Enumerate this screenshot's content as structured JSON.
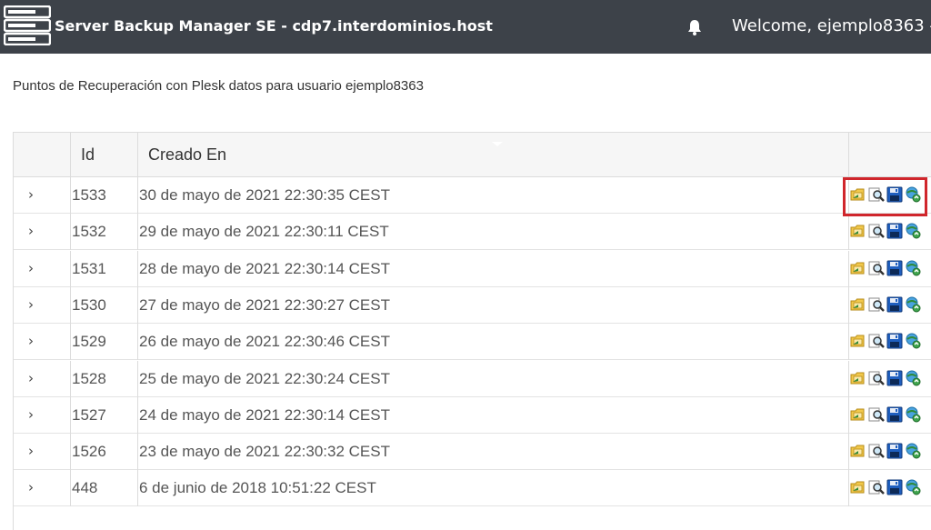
{
  "header": {
    "app_title": "Server Backup Manager SE - cdp7.interdominios.host",
    "welcome": "Welcome, ejemplo8363 -",
    "bar_color": "#3d4249"
  },
  "page": {
    "subtitle": "Puntos de Recuperación con Plesk datos para usuario ejemplo8363"
  },
  "table": {
    "columns": [
      "",
      "Id",
      "Creado En",
      ""
    ],
    "row_icons": [
      "folder-restore-icon",
      "magnifier-browse-icon",
      "floppy-download-icon",
      "network-restore-icon"
    ],
    "rows": [
      {
        "id": "1533",
        "created": "30 de mayo de 2021 22:30:35 CEST"
      },
      {
        "id": "1532",
        "created": "29 de mayo de 2021 22:30:11 CEST"
      },
      {
        "id": "1531",
        "created": "28 de mayo de 2021 22:30:14 CEST"
      },
      {
        "id": "1530",
        "created": "27 de mayo de 2021 22:30:27 CEST"
      },
      {
        "id": "1529",
        "created": "26 de mayo de 2021 22:30:46 CEST"
      },
      {
        "id": "1528",
        "created": "25 de mayo de 2021 22:30:24 CEST"
      },
      {
        "id": "1527",
        "created": "24 de mayo de 2021 22:30:14 CEST"
      },
      {
        "id": "1526",
        "created": "23 de mayo de 2021 22:30:32 CEST"
      },
      {
        "id": "448",
        "created": "6 de junio de 2018 10:51:22 CEST"
      }
    ]
  },
  "highlight": {
    "color": "#d0262c",
    "target_row_index": 0
  }
}
